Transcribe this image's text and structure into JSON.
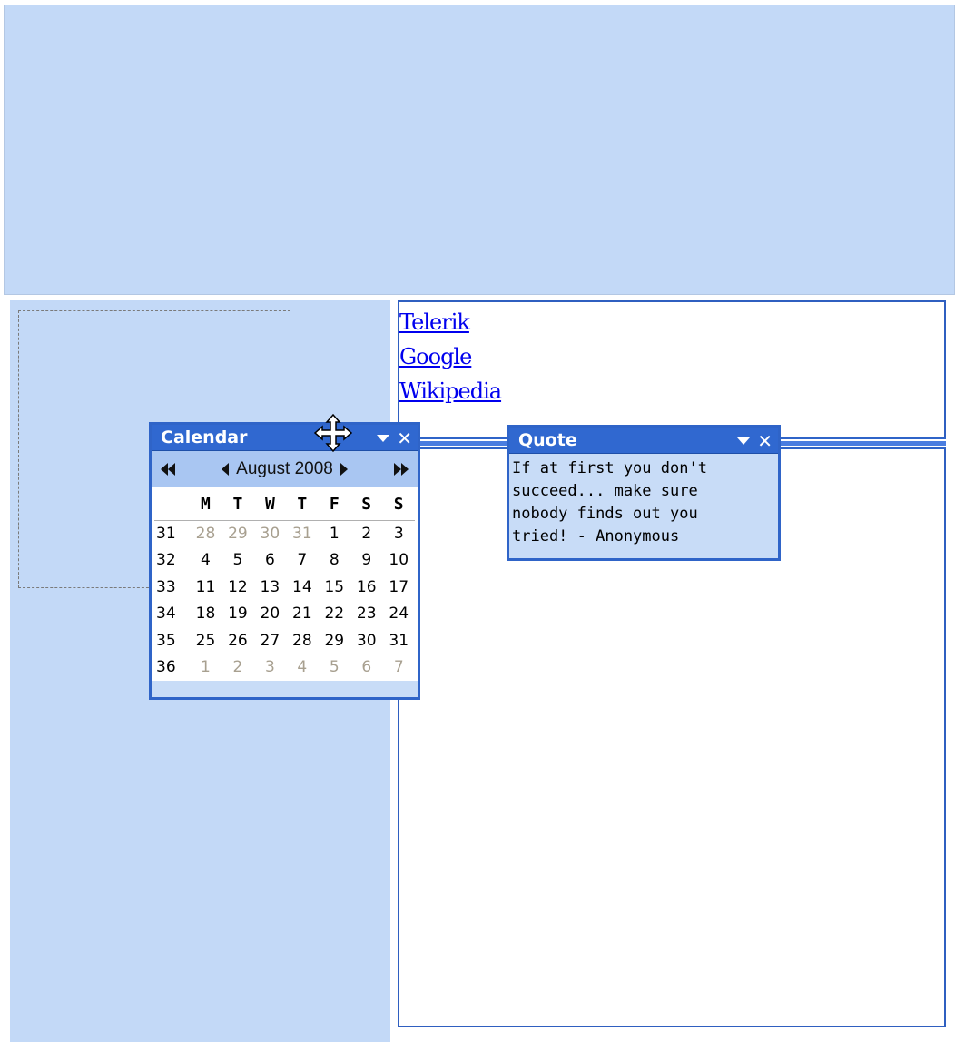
{
  "links": [
    "Telerik",
    "Google",
    "Wikipedia"
  ],
  "calendar_dock": {
    "title": "Calendar",
    "nav": {
      "month_label": "August 2008"
    },
    "day_headers": [
      "M",
      "T",
      "W",
      "T",
      "F",
      "S",
      "S"
    ],
    "weeks": [
      {
        "week": "31",
        "days": [
          "28",
          "29",
          "30",
          "31",
          "1",
          "2",
          "3"
        ],
        "other": [
          true,
          true,
          true,
          true,
          false,
          false,
          false
        ]
      },
      {
        "week": "32",
        "days": [
          "4",
          "5",
          "6",
          "7",
          "8",
          "9",
          "10"
        ],
        "other": [
          false,
          false,
          false,
          false,
          false,
          false,
          false
        ]
      },
      {
        "week": "33",
        "days": [
          "11",
          "12",
          "13",
          "14",
          "15",
          "16",
          "17"
        ],
        "other": [
          false,
          false,
          false,
          false,
          false,
          false,
          false
        ]
      },
      {
        "week": "34",
        "days": [
          "18",
          "19",
          "20",
          "21",
          "22",
          "23",
          "24"
        ],
        "other": [
          false,
          false,
          false,
          false,
          false,
          false,
          false
        ]
      },
      {
        "week": "35",
        "days": [
          "25",
          "26",
          "27",
          "28",
          "29",
          "30",
          "31"
        ],
        "other": [
          false,
          false,
          false,
          false,
          false,
          false,
          false
        ]
      },
      {
        "week": "36",
        "days": [
          "1",
          "2",
          "3",
          "4",
          "5",
          "6",
          "7"
        ],
        "other": [
          true,
          true,
          true,
          true,
          true,
          true,
          true
        ]
      }
    ]
  },
  "quote_dock": {
    "title": "Quote",
    "lines": [
      "If at first you don't",
      "succeed... make sure",
      "nobody finds out you",
      "tried! - Anonymous"
    ]
  },
  "colors": {
    "zone_background": "#c3d9f7",
    "dock_title": "#3068d0",
    "dock_border": "#2f64c8",
    "link": "#0000ee",
    "other_month_day": "#a8a090"
  },
  "icons": [
    "move-cursor-icon",
    "collapse-icon",
    "close-icon",
    "fast-prev-icon",
    "prev-icon",
    "next-icon",
    "fast-next-icon"
  ]
}
